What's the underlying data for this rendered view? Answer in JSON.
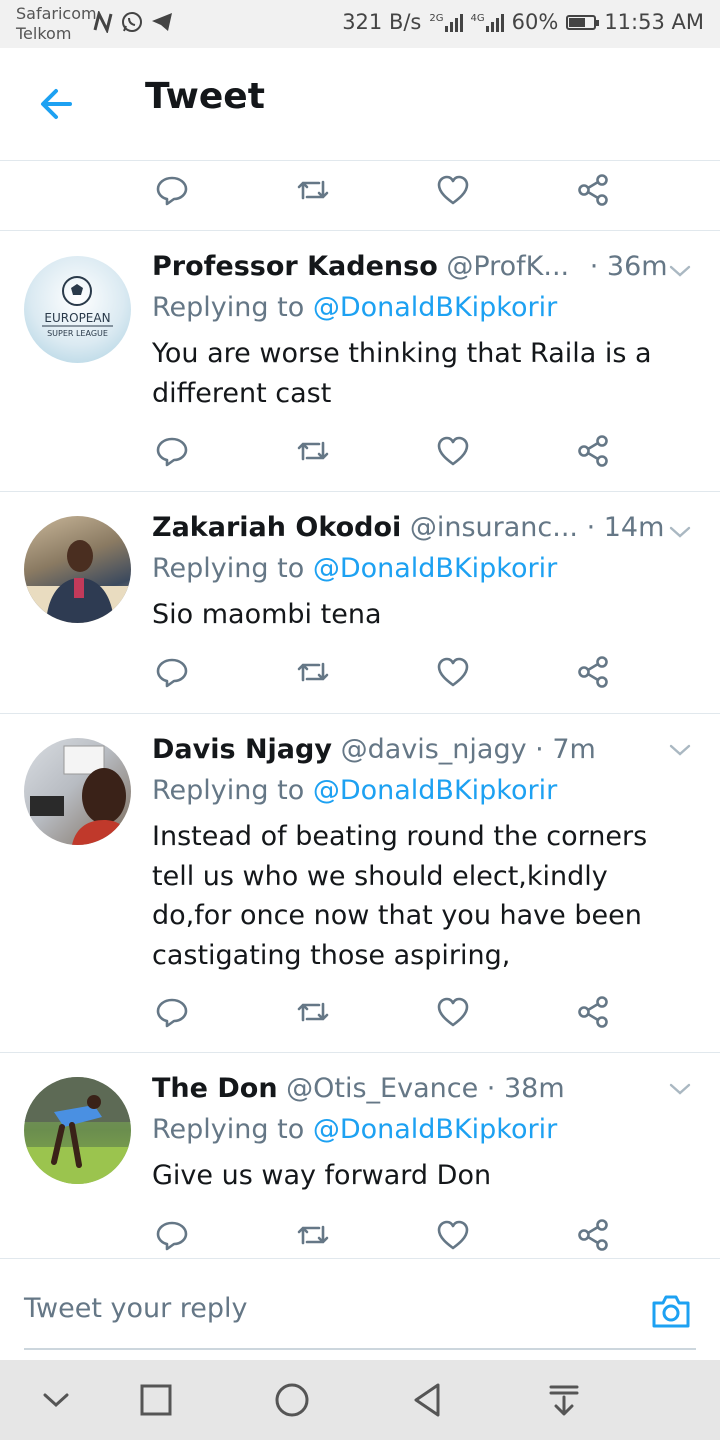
{
  "statusbar": {
    "carrier1": "Safaricom",
    "carrier2": "Telkom",
    "speed": "321 B/s",
    "net1": "2G",
    "net2": "4G",
    "battery": "60%",
    "time": "11:53 AM"
  },
  "header": {
    "title": "Tweet"
  },
  "tweets": [
    {
      "name": "Professor Kadenso",
      "handle": "@ProfK...",
      "time": "· 36m",
      "replying_prefix": "Replying to ",
      "replying_to": "@DonaldBKipkorir",
      "text": "You are worse thinking that Raila is a different cast",
      "avatar_text1": "EUROPEAN",
      "avatar_text2": "SUPER LEAGUE"
    },
    {
      "name": "Zakariah Okodoi",
      "handle": "@insuranc...",
      "time": "· 14m",
      "replying_prefix": "Replying to ",
      "replying_to": "@DonaldBKipkorir",
      "text": "Sio maombi tena"
    },
    {
      "name": "Davis Njagy",
      "handle": "@davis_njagy",
      "time": "· 7m",
      "replying_prefix": "Replying to ",
      "replying_to": "@DonaldBKipkorir",
      "text": "Instead of beating round the corners tell us who we should elect,kindly do,for once now that you have been castigating those aspiring,"
    },
    {
      "name": "The Don",
      "handle": "@Otis_Evance",
      "time": "· 38m",
      "replying_prefix": "Replying to ",
      "replying_to": "@DonaldBKipkorir",
      "text": "Give us way forward Don"
    }
  ],
  "reply_bar": {
    "placeholder": "Tweet your reply"
  },
  "colors": {
    "accent": "#1da1f2",
    "secondary_text": "#657786",
    "divider": "#e1e8ed"
  },
  "icons": [
    "back-arrow-icon",
    "reply-icon",
    "retweet-icon",
    "like-icon",
    "share-icon",
    "chevron-down-icon",
    "camera-icon"
  ]
}
